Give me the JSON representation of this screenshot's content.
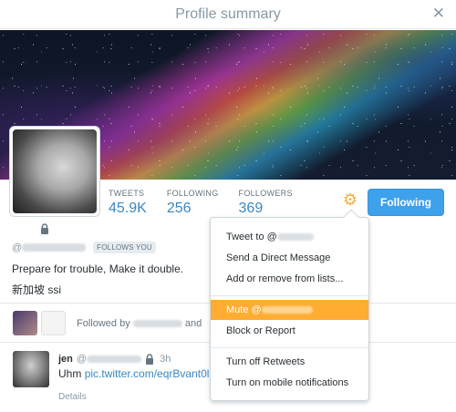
{
  "modal": {
    "title": "Profile summary",
    "close_icon": "close-icon"
  },
  "profile": {
    "stats": [
      {
        "label": "TWEETS",
        "value": "45.9K"
      },
      {
        "label": "FOLLOWING",
        "value": "256"
      },
      {
        "label": "FOLLOWERS",
        "value": "369"
      }
    ],
    "at_symbol": "@",
    "follows_you": "FOLLOWS YOU",
    "bio": "Prepare for trouble, Make it double.",
    "location": "新加坡 ssi",
    "followed_by_prefix": "Followed by",
    "followed_by_suffix": "and",
    "following_button": "Following",
    "gear_icon": "gear-icon"
  },
  "tweet": {
    "name": "jen",
    "handle_prefix": "@",
    "time": "3h",
    "text": "Uhm",
    "link": "pic.twitter.com/eqrBvant0l",
    "details": "Details"
  },
  "dropdown": {
    "items": [
      {
        "label": "Tweet to @"
      },
      {
        "label": "Send a Direct Message"
      },
      {
        "label": "Add or remove from lists..."
      },
      {
        "label": "Mute @"
      },
      {
        "label": "Block or Report"
      },
      {
        "label": "Turn off Retweets"
      },
      {
        "label": "Turn on mobile notifications"
      }
    ]
  },
  "colors": {
    "accent": "#3ea1ec",
    "link": "#3b88c3",
    "highlight": "#ffac33"
  }
}
